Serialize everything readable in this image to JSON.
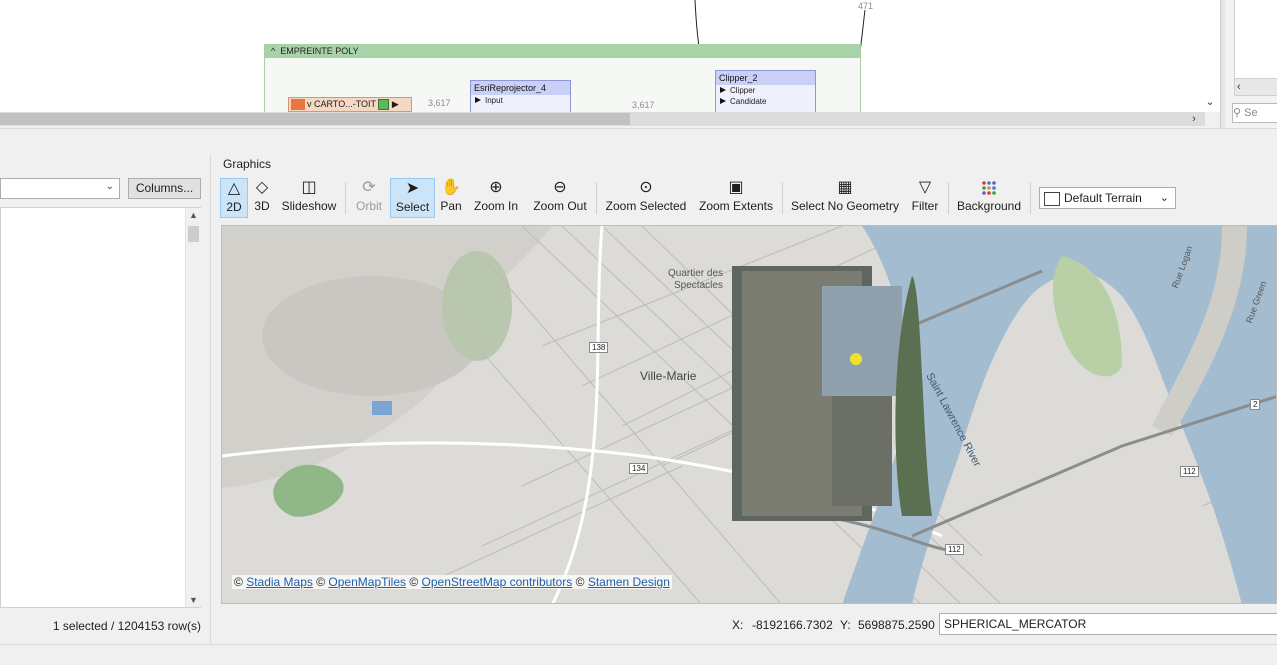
{
  "canvas": {
    "bookmark_title": "EMPREINTE POLY",
    "reader_label": "CARTO...-TOIT",
    "reprojector": {
      "title": "EsriReprojector_4",
      "port": "Input"
    },
    "clipper": {
      "title": "Clipper_2",
      "ports": [
        "Clipper",
        "Candidate"
      ]
    },
    "counts": {
      "reader_out": "3,617",
      "reproj_out": "3,617",
      "top": "471"
    }
  },
  "right_pane": {
    "search_placeholder": "Se"
  },
  "left_panel": {
    "columns_button": "Columns...",
    "row_status": "1 selected / 1204153 row(s)"
  },
  "graphics": {
    "label": "Graphics",
    "toolbar": [
      {
        "id": "2d",
        "label": "2D",
        "icon": "triangle-icon",
        "state": "active"
      },
      {
        "id": "3d",
        "label": "3D",
        "icon": "prism-icon",
        "state": "normal"
      },
      {
        "id": "slideshow",
        "label": "Slideshow",
        "icon": "slideshow-icon",
        "state": "normal"
      },
      {
        "id": "orbit",
        "label": "Orbit",
        "icon": "orbit-icon",
        "state": "disabled"
      },
      {
        "id": "select",
        "label": "Select",
        "icon": "cursor-icon",
        "state": "active"
      },
      {
        "id": "pan",
        "label": "Pan",
        "icon": "hand-icon",
        "state": "normal"
      },
      {
        "id": "zoom_in",
        "label": "Zoom In",
        "icon": "zoom-in-icon",
        "state": "normal"
      },
      {
        "id": "zoom_out",
        "label": "Zoom Out",
        "icon": "zoom-out-icon",
        "state": "normal"
      },
      {
        "id": "zoom_selected",
        "label": "Zoom Selected",
        "icon": "zoom-selected-icon",
        "state": "normal"
      },
      {
        "id": "zoom_extents",
        "label": "Zoom Extents",
        "icon": "zoom-extents-icon",
        "state": "normal"
      },
      {
        "id": "select_no_geometry",
        "label": "Select No Geometry",
        "icon": "table-icon",
        "state": "normal"
      },
      {
        "id": "filter",
        "label": "Filter",
        "icon": "filter-icon",
        "state": "normal"
      },
      {
        "id": "background",
        "label": "Background",
        "icon": "grid-dots-icon",
        "state": "normal"
      }
    ],
    "terrain": "Default Terrain"
  },
  "map": {
    "labels": {
      "quartier": "Quartier des",
      "spectacles": "Spectacles",
      "ville_marie": "Ville-Marie",
      "river": "Saint Lawrence River",
      "rue_logan": "Rue Logan",
      "rue_green": "Rue Green",
      "route_138": "138",
      "route_134": "134",
      "route_112a": "112",
      "route_112b": "112",
      "route_2": "2"
    },
    "attribution": {
      "c1": "©",
      "stadia": "Stadia Maps",
      "c2": "©",
      "openmaptiles": "OpenMapTiles",
      "c3": "©",
      "osm": "OpenStreetMap contributors",
      "c4": "©",
      "stamen": "Stamen Design"
    }
  },
  "status": {
    "x_label": "X:",
    "x_value": "-8192166.7302",
    "y_label": "Y:",
    "y_value": "5698875.2590",
    "crs": "SPHERICAL_MERCATOR"
  }
}
